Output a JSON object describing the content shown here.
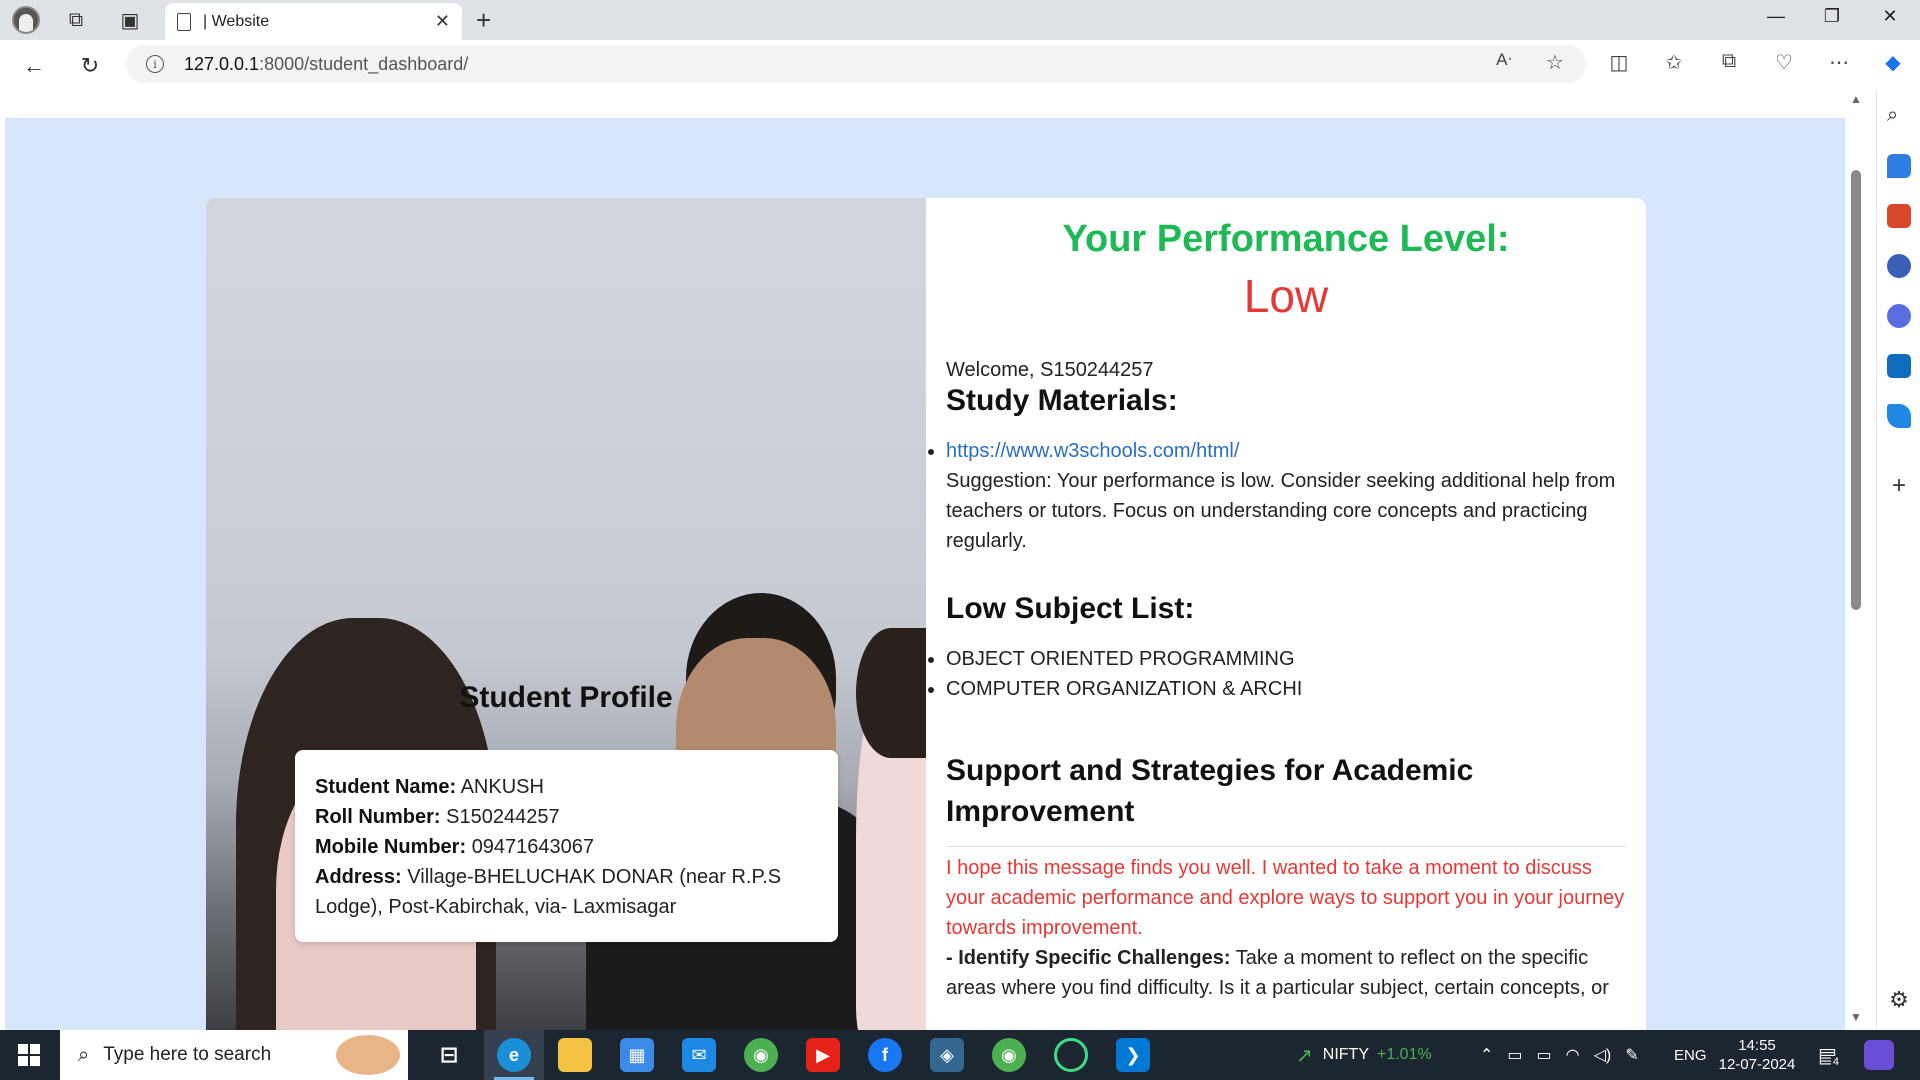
{
  "browser": {
    "tab_title": "| Website",
    "url_host": "127.0.0.1",
    "url_path": ":8000/student_dashboard/"
  },
  "icons": {
    "profile": "avatar-icon",
    "workspaces": "workspaces-icon",
    "tab_actions": "tab-actions-icon",
    "page": "page-icon",
    "close": "close-icon",
    "new_tab": "plus-icon",
    "back": "back-arrow-icon",
    "refresh": "refresh-icon",
    "info": "info-icon",
    "read_aloud": "read-aloud-icon",
    "favorite": "star-icon",
    "split": "split-screen-icon",
    "favorites": "favorites-icon",
    "collections": "collections-icon",
    "performance": "heart-pulse-icon",
    "more": "more-icon",
    "copilot": "copilot-icon"
  },
  "page": {
    "performance_heading": "Your Performance Level:",
    "performance_level": "Low",
    "welcome": "Welcome, S150244257",
    "study_materials_heading": "Study Materials:",
    "study_link": "https://www.w3schools.com/html/",
    "suggestion": "Suggestion: Your performance is low. Consider seeking additional help from teachers or tutors. Focus on understanding core concepts and practicing regularly.",
    "low_subjects_heading": "Low Subject List:",
    "low_subjects": [
      "OBJECT ORIENTED PROGRAMMING",
      "COMPUTER ORGANIZATION & ARCHI"
    ],
    "support_heading": "Support and Strategies for Academic Improvement",
    "support_message": "I hope this message finds you well. I wanted to take a moment to discuss your academic performance and explore ways to support you in your journey towards improvement.",
    "challenge_label": "- Identify Specific Challenges:",
    "challenge_text": "Take a moment to reflect on the specific areas where you find difficulty. Is it a particular subject, certain concepts, or"
  },
  "profile": {
    "title": "Student Profile",
    "name_label": "Student Name:",
    "name": "ANKUSH",
    "roll_label": "Roll Number:",
    "roll": "S150244257",
    "mobile_label": "Mobile Number:",
    "mobile": "09471643067",
    "address_label": "Address:",
    "address": "Village-BHELUCHAK DONAR (near R.P.S Lodge), Post-Kabirchak, via- Laxmisagar"
  },
  "taskbar": {
    "search_placeholder": "Type here to search",
    "nifty_label": "NIFTY",
    "nifty_change": "+1.01%",
    "language": "ENG",
    "time": "14:55",
    "date": "12-07-2024",
    "notification_count": "4"
  },
  "colors": {
    "performance_heading": "#1db954",
    "performance_level": "#e53935",
    "link": "#2a6ec2",
    "page_background": "#d7e6fb",
    "taskbar": "#1c2631"
  }
}
